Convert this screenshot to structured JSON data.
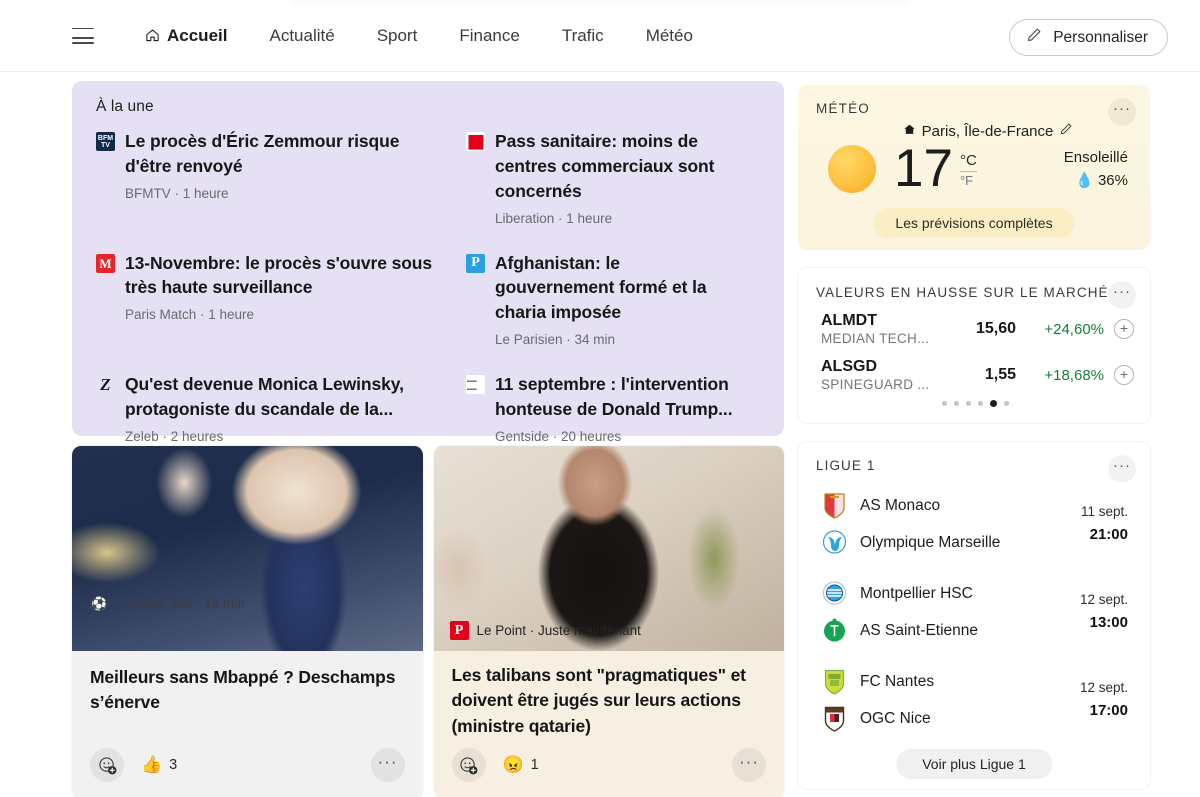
{
  "nav": {
    "menu_icon": "hamburger-icon",
    "items": [
      {
        "label": "Accueil",
        "icon": "home-icon",
        "active": true
      },
      {
        "label": "Actualité",
        "active": false
      },
      {
        "label": "Sport",
        "active": false
      },
      {
        "label": "Finance",
        "active": false
      },
      {
        "label": "Trafic",
        "active": false
      },
      {
        "label": "Météo",
        "active": false
      }
    ],
    "personalize": {
      "label": "Personnaliser",
      "icon": "pencil-icon"
    }
  },
  "headlines": {
    "title": "À la une",
    "stories": [
      {
        "headline": "Le procès d'Éric Zemmour risque d'être renvoyé",
        "source": "BFMTV",
        "time": "1 heure",
        "byline": "BFMTV · 1 heure",
        "icon": "bfmtv-logo"
      },
      {
        "headline": "Pass sanitaire: moins de centres commerciaux sont concernés",
        "source": "Liberation",
        "time": "1 heure",
        "byline": "Liberation · 1 heure",
        "icon": "liberation-logo"
      },
      {
        "headline": "13-Novembre: le procès s'ouvre sous très haute surveillance",
        "source": "Paris Match",
        "time": "1 heure",
        "byline": "Paris Match · 1 heure",
        "icon": "parismatch-logo"
      },
      {
        "headline": "Afghanistan: le gouvernement formé et la charia imposée",
        "source": "Le Parisien",
        "time": "34 min",
        "byline": "Le Parisien · 34 min",
        "icon": "leparisien-logo"
      },
      {
        "headline": "Qu'est devenue Monica Lewinsky, protagoniste du scandale de la...",
        "source": "Zeleb",
        "time": "2 heures",
        "byline": "Zeleb · 2 heures",
        "icon": "zeleb-logo"
      },
      {
        "headline": "11 septembre : l'intervention honteuse de Donald Trump...",
        "source": "Gentside",
        "time": "20 heures",
        "byline": "Gentside · 20 heures",
        "icon": "gentside-logo"
      }
    ]
  },
  "cards": [
    {
      "source": "Football 365",
      "time": "18 min",
      "byline": "Football 365 · 18 min",
      "title": "Meilleurs sans Mbappé ? Deschamps s’énerve",
      "source_icon": "football365-logo",
      "react_add_icon": "add-reaction-icon",
      "reaction_emoji": "👍",
      "reaction_count": "3",
      "more_icon": "more-options-icon"
    },
    {
      "source": "Le Point",
      "time": "Juste maintenant",
      "byline": "Le Point · Juste maintenant",
      "title": "Les talibans sont \"pragmatiques\" et doivent être jugés sur leurs actions (ministre qatarie)",
      "source_icon": "lepoint-logo",
      "react_add_icon": "add-reaction-icon",
      "reaction_emoji": "😠",
      "reaction_count": "1",
      "more_icon": "more-options-icon"
    }
  ],
  "weather": {
    "label": "MÉTÉO",
    "location": "Paris, Île-de-France",
    "location_icon": "home-icon",
    "edit_icon": "pencil-icon",
    "condition_icon": "sun-icon",
    "temperature": "17",
    "unit_celsius": "°C",
    "unit_fahrenheit": "°F",
    "condition": "Ensoleillé",
    "humidity": "36%",
    "humidity_icon": "droplet-icon",
    "cta": "Les prévisions complètes",
    "more_icon": "more-options-icon"
  },
  "stocks": {
    "label": "VALEURS EN HAUSSE SUR LE MARCHÉ",
    "more_icon": "more-options-icon",
    "rows": [
      {
        "symbol": "ALMDT",
        "name": "MEDIAN TECH...",
        "price": "15,60",
        "change": "+24,60%",
        "add_icon": "plus-circle-icon"
      },
      {
        "symbol": "ALSGD",
        "name": "SPINEGUARD ...",
        "price": "1,55",
        "change": "+18,68%",
        "add_icon": "plus-circle-icon"
      }
    ],
    "pager_total": 6,
    "pager_active": 5,
    "positive_color": "#13823a"
  },
  "ligue1": {
    "label": "LIGUE 1",
    "more_icon": "more-options-icon",
    "matches": [
      {
        "home": "AS Monaco",
        "away": "Olympique Marseille",
        "date": "11 sept.",
        "time": "21:00",
        "home_crest": "as-monaco-crest",
        "away_crest": "olympique-marseille-crest"
      },
      {
        "home": "Montpellier HSC",
        "away": "AS Saint-Etienne",
        "date": "12 sept.",
        "time": "13:00",
        "home_crest": "montpellier-hsc-crest",
        "away_crest": "as-saint-etienne-crest"
      },
      {
        "home": "FC Nantes",
        "away": "OGC Nice",
        "date": "12 sept.",
        "time": "17:00",
        "home_crest": "fc-nantes-crest",
        "away_crest": "ogc-nice-crest"
      }
    ],
    "cta": "Voir plus Ligue 1"
  }
}
